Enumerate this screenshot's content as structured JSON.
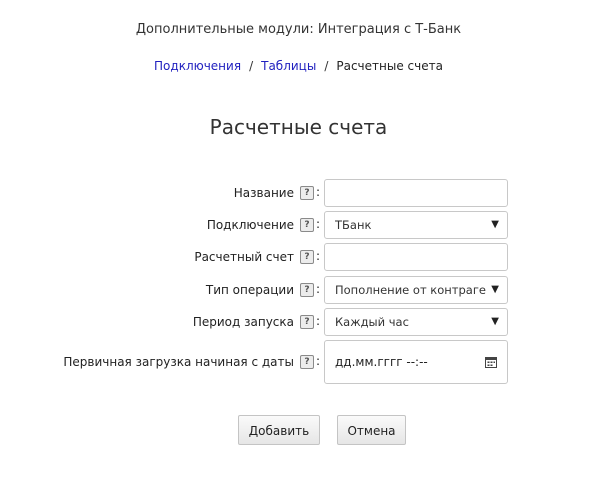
{
  "header": {
    "app_title": "Дополнительные модули: Интеграция с Т-Банк"
  },
  "breadcrumb": {
    "items": [
      "Подключения",
      "Таблицы",
      "Расчетные счета"
    ],
    "separator": "/"
  },
  "page": {
    "title": "Расчетные счета"
  },
  "form": {
    "help_glyph": "?",
    "colon": ":",
    "name": {
      "label": "Название",
      "value": ""
    },
    "connection": {
      "label": "Подключение",
      "value": "ТБанк"
    },
    "account": {
      "label": "Расчетный счет",
      "value": ""
    },
    "operation_type": {
      "label": "Тип операции",
      "value": "Пополнение от контраге..."
    },
    "period": {
      "label": "Период запуска",
      "value": "Каждый час"
    },
    "initial_load": {
      "label": "Первичная загрузка начиная с даты",
      "value": "дд.мм.гггг --:--"
    }
  },
  "actions": {
    "add_label": "Добавить",
    "cancel_label": "Отмена"
  },
  "colors": {
    "link": "#1f1fbf",
    "border": "#c8c8c8"
  },
  "icons": {
    "help": "help-icon",
    "dropdown": "chevron-down-icon",
    "calendar": "calendar-icon"
  }
}
